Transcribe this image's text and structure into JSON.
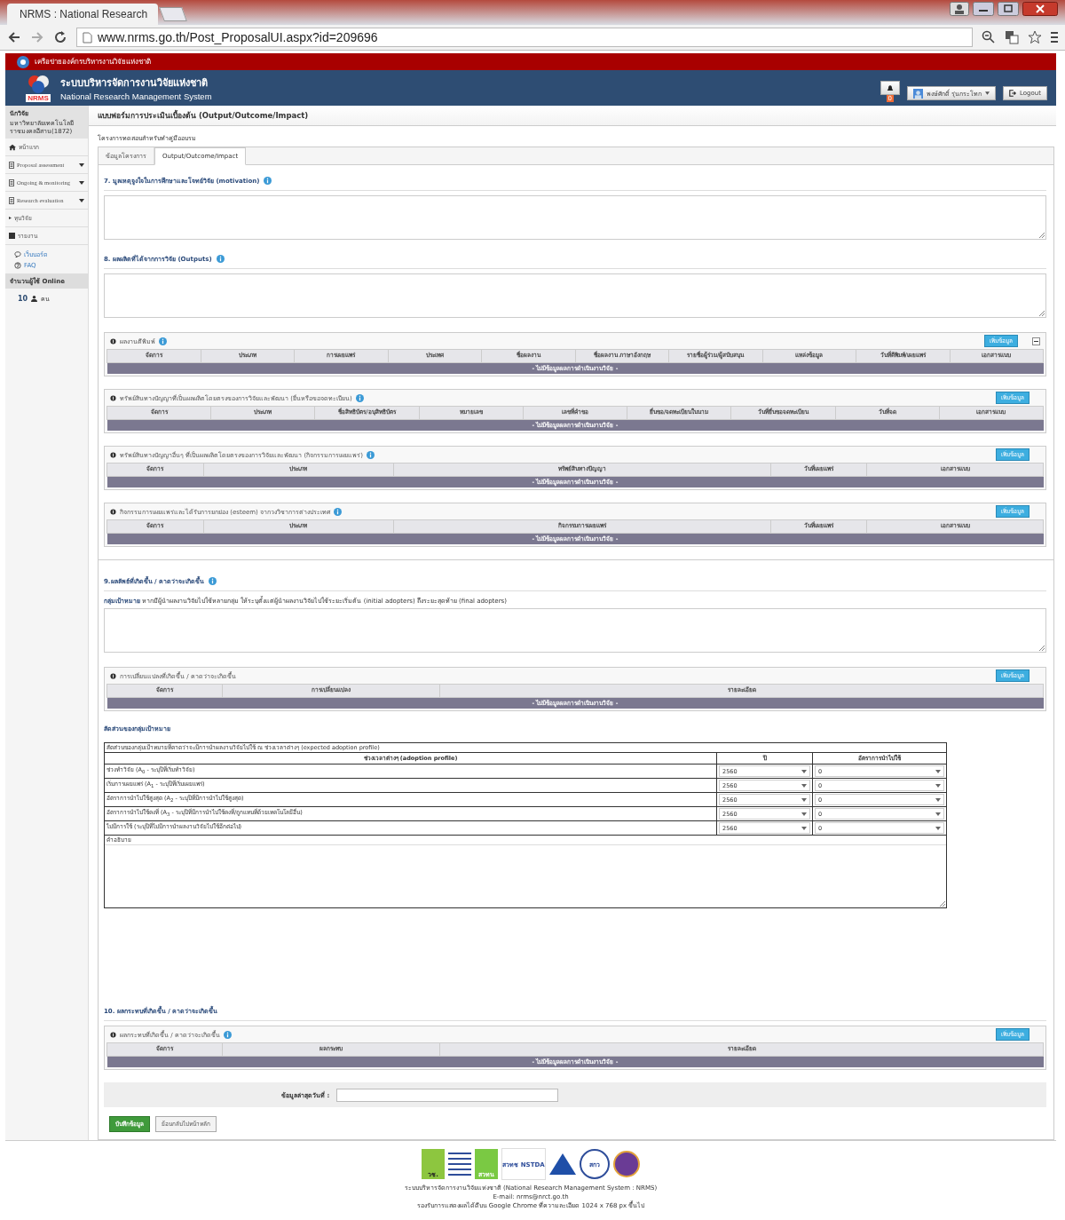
{
  "browser": {
    "tab_title": "NRMS : National Research",
    "url": "www.nrms.go.th/Post_ProposalUI.aspx?id=209696"
  },
  "header": {
    "network_name": "เครือข่ายองค์กรบริหารงานวิจัยแห่งชาติ",
    "logo_text": "NRMS",
    "title_th": "ระบบบริหารจัดการงานวิจัยแห่งชาติ",
    "title_en": "National Research Management System",
    "notification_count": "0",
    "user_name": "พงษ์ศักดิ์ รุ่นกระโทก",
    "logout": "Logout"
  },
  "sidebar": {
    "role": "นักวิจัย",
    "organization": "มหาวิทยาลัยเทคโนโลยีราชมงคลอีสาน(1872)",
    "items": [
      {
        "kind": "home",
        "label": "หน้าแรก",
        "dropdown": false
      },
      {
        "kind": "form",
        "label": "Proposal assessment",
        "dropdown": true
      },
      {
        "kind": "form",
        "label": "Ongoing & monitoring",
        "dropdown": true
      },
      {
        "kind": "form",
        "label": "Research evaluation",
        "dropdown": true
      },
      {
        "kind": "bullet",
        "label": "ทุนวิจัย",
        "dropdown": false
      },
      {
        "kind": "report",
        "label": "รายงาน",
        "dropdown": false
      }
    ],
    "links": [
      {
        "kind": "chat",
        "label": "เว็บบอร์ด"
      },
      {
        "kind": "help",
        "label": "FAQ"
      }
    ],
    "online_title": "จำนวนผู้ใช้ Online",
    "online_count": "10",
    "online_unit": "คน"
  },
  "page_title": "แบบฟอร์มการประเมินเบื้องต้น (Output/Outcome/Impact)",
  "project_name": "โครงการทดสอบสำหรับทำคู่มืออบรม",
  "tabs": [
    {
      "label": "ข้อมูลโครงการ",
      "selected": false
    },
    {
      "label": "Output/Outcome/Impact",
      "selected": true
    }
  ],
  "blocks": [
    {
      "kind": "heading",
      "text": "7. มูลเหตุจูงใจในการศึกษาและโจทย์วิจัย (motivation)",
      "info": true
    },
    {
      "kind": "textarea"
    },
    {
      "kind": "heading",
      "text": "8. ผลผลิตที่ได้จากการวิจัย (Outputs)",
      "info": true
    },
    {
      "kind": "textarea"
    },
    {
      "kind": "panel",
      "title": "ผลงานตีพิมพ์",
      "info": true,
      "collapsible": true,
      "add_button": "เพิ่มข้อมูล",
      "columns": [
        "จัดการ",
        "ประเภท",
        "การเผยแพร่",
        "ประเทศ",
        "ชื่อผลงาน",
        "ชื่อผลงาน ภาษาอังกฤษ",
        "รายชื่อผู้ร่วม/ผู้สนับสนุน",
        "แหล่งข้อมูล",
        "วันที่ตีพิมพ์/เผยแพร่",
        "เอกสารแนบ"
      ],
      "empty_message": "- ไม่มีข้อมูลผลการดำเนินงานวิจัย -"
    },
    {
      "kind": "panel",
      "title": "ทรัพย์สินทางปัญญาที่เป็นผลผลิตโดยตรงของการวิจัยและพัฒนา (ยื่นหรือขอจดทะเบียน)",
      "info": true,
      "collapsible": false,
      "add_button": "เพิ่มข้อมูล",
      "columns": [
        "จัดการ",
        "ประเภท",
        "ชื่อสิทธิบัตร/อนุสิทธิบัตร",
        "หมายเลข",
        "เลขที่คำขอ",
        "ยื่นขอ/จดทะเบียนในนาม",
        "วันที่ยื่นขอจดทะเบียน",
        "วันที่จด",
        "เอกสารแนบ"
      ],
      "empty_message": "- ไม่มีข้อมูลผลการดำเนินงานวิจัย -"
    },
    {
      "kind": "panel",
      "title": "ทรัพย์สินทางปัญญาอื่นๆ ที่เป็นผลผลิตโดยตรงของการวิจัยและพัฒนา (กิจกรรมการเผยแพร่)",
      "info": true,
      "collapsible": false,
      "add_button": "เพิ่มข้อมูล",
      "columns": [
        "จัดการ",
        "ประเภท",
        "ทรัพย์สินทางปัญญา",
        "วันที่เผยแพร่",
        "เอกสารแนบ"
      ],
      "empty_message": "- ไม่มีข้อมูลผลการดำเนินงานวิจัย -"
    },
    {
      "kind": "panel",
      "title": "กิจกรรมการเผยแพร่และได้รับการยกย่อง (esteem) จากวงวิชาการต่างประเทศ",
      "info": true,
      "collapsible": false,
      "add_button": "เพิ่มข้อมูล",
      "columns": [
        "จัดการ",
        "ประเภท",
        "กิจกรรมการเผยแพร่",
        "วันที่เผยแพร่",
        "เอกสารแนบ"
      ],
      "empty_message": "- ไม่มีข้อมูลผลการดำเนินงานวิจัย -"
    },
    {
      "kind": "divider"
    },
    {
      "kind": "heading",
      "text": "9.ผลลัพธ์ที่เกิดขึ้น / คาดว่าจะเกิดขึ้น",
      "info": true
    },
    {
      "kind": "note",
      "text": "**กลุ่มเป้าหมาย** หากมีผู้นำผลงานวิจัยไปใช้หลายกลุ่ม ให้ระบุตั้งแต่ผู้นำผลงานวิจัยไปใช้ระยะเริ่มต้น (initial adopters) ถึงระยะสุดท้าย (final adopters)"
    },
    {
      "kind": "textarea"
    },
    {
      "kind": "panel",
      "title": "การเปลี่ยนแปลงที่เกิดขึ้น / คาดว่าจะเกิดขึ้น",
      "info": false,
      "collapsible": false,
      "add_button": "เพิ่มข้อมูล",
      "columns": [
        "จัดการ",
        "การเปลี่ยนแปลง",
        "รายละเอียด"
      ],
      "empty_message": "- ไม่มีข้อมูลผลการดำเนินงานวิจัย -"
    },
    {
      "kind": "subheading",
      "text": "สัดส่วนของกลุ่มเป้าหมาย"
    },
    {
      "kind": "adoption",
      "caption": "สัดส่วนของกลุ่มเป้าหมายที่คาดว่าจะมีการนำผลงานวิจัยไปใช้ ณ ช่วงเวลาต่างๆ (expected adoption profile)",
      "columns": [
        "ช่วงเวลาต่างๆ (adoption profile)",
        "ปี",
        "อัตราการนำไปใช้"
      ],
      "rows": [
        {
          "label": "ช่วงทำวิจัย (A$_{0}$ - ระบุปีที่เริ่มทำวิจัย)",
          "year": "2560",
          "rate": "0"
        },
        {
          "label": "เริ่มการเผยแพร่ (A$_{1}$ - ระบุปีที่เริ่มเผยแพร่)",
          "year": "2560",
          "rate": "0"
        },
        {
          "label": "อัตราการนำไปใช้สูงสุด (A$_{2}$ - ระบุปีที่มีการนำไปใช้สูงสุด)",
          "year": "2560",
          "rate": "0"
        },
        {
          "label": "อัตราการนำไปใช้คงที่ (A$_{3}$ - ระบุปีที่มีการนำไปใช้คงที่/ถูกแทนที่ด้วยเทคโนโลยีอื่น)",
          "year": "2560",
          "rate": "0"
        },
        {
          "label": "ไม่มีการใช้ (ระบุปีที่ไม่มีการนำผลงานวิจัยไปใช้อีกต่อไป)",
          "year": "2560",
          "rate": "0"
        }
      ],
      "note_label": "คำอธิบาย"
    },
    {
      "kind": "spacer"
    },
    {
      "kind": "heading",
      "text": "10. ผลกระทบที่เกิดขึ้น / คาดว่าจะเกิดขึ้น",
      "info": false
    },
    {
      "kind": "panel",
      "title": "ผลกระทบที่เกิดขึ้น / คาดว่าจะเกิดขึ้น",
      "info": true,
      "collapsible": false,
      "add_button": "เพิ่มข้อมูล",
      "columns": [
        "จัดการ",
        "ผลกระทบ",
        "รายละเอียด"
      ],
      "empty_message": "- ไม่มีข้อมูลผลการดำเนินงานวิจัย -"
    }
  ],
  "last_update_label": "ข้อมูลล่าสุดวันที่ :",
  "buttons": [
    {
      "kind": "primary",
      "label": "บันทึกข้อมูล"
    },
    {
      "kind": "default",
      "label": "ย้อนกลับไปหน้าหลัก"
    }
  ],
  "footer": {
    "logos": [
      {
        "kind": "seal",
        "label": "วช."
      },
      {
        "kind": "stripes"
      },
      {
        "kind": "block",
        "label": "สวทน"
      },
      {
        "kind": "wordmark",
        "label": "สวทช NSTDA"
      },
      {
        "kind": "triangle"
      },
      {
        "kind": "circle",
        "label": "สกว"
      },
      {
        "kind": "emblem"
      }
    ],
    "lines": [
      "ระบบบริหารจัดการงานวิจัยแห่งชาติ (National Research Management System : NRMS)",
      "E-mail: nrms@nrct.go.th",
      "รองรับการแสดงผลได้ดีบน Google Chrome ที่ความละเอียด 1024 x 768 px ขึ้นไป"
    ]
  }
}
